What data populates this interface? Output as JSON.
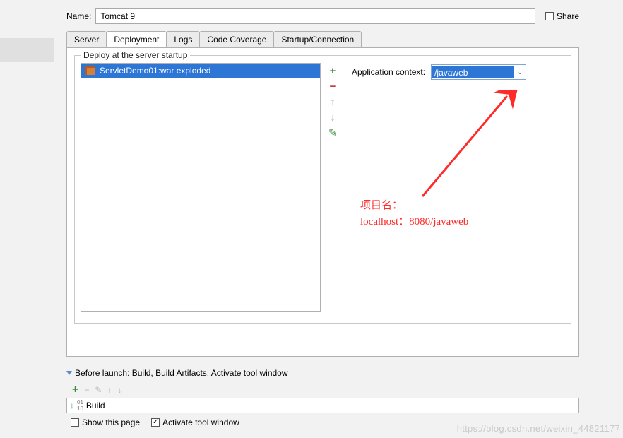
{
  "name": {
    "label_pre": "N",
    "label_post": "ame:",
    "value": "Tomcat 9"
  },
  "share": {
    "label_pre": "S",
    "label_post": "hare"
  },
  "tabs": [
    "Server",
    "Deployment",
    "Logs",
    "Code Coverage",
    "Startup/Connection"
  ],
  "deploy": {
    "section_label": "Deploy at the server startup",
    "items": [
      "ServletDemo01:war exploded"
    ],
    "app_ctx_label": "Application context:",
    "app_ctx_value": "/javaweb"
  },
  "annotation": {
    "line1": "项目名：",
    "line2": "localhost：8080/javaweb"
  },
  "before_launch": {
    "header_pre": "B",
    "header_mid": "efore launch: Build, Build Artifacts, Activate tool window",
    "task": "Build",
    "show_page": "Show this page",
    "activate": "Activate tool window"
  },
  "watermark": "https://blog.csdn.net/weixin_44821177"
}
